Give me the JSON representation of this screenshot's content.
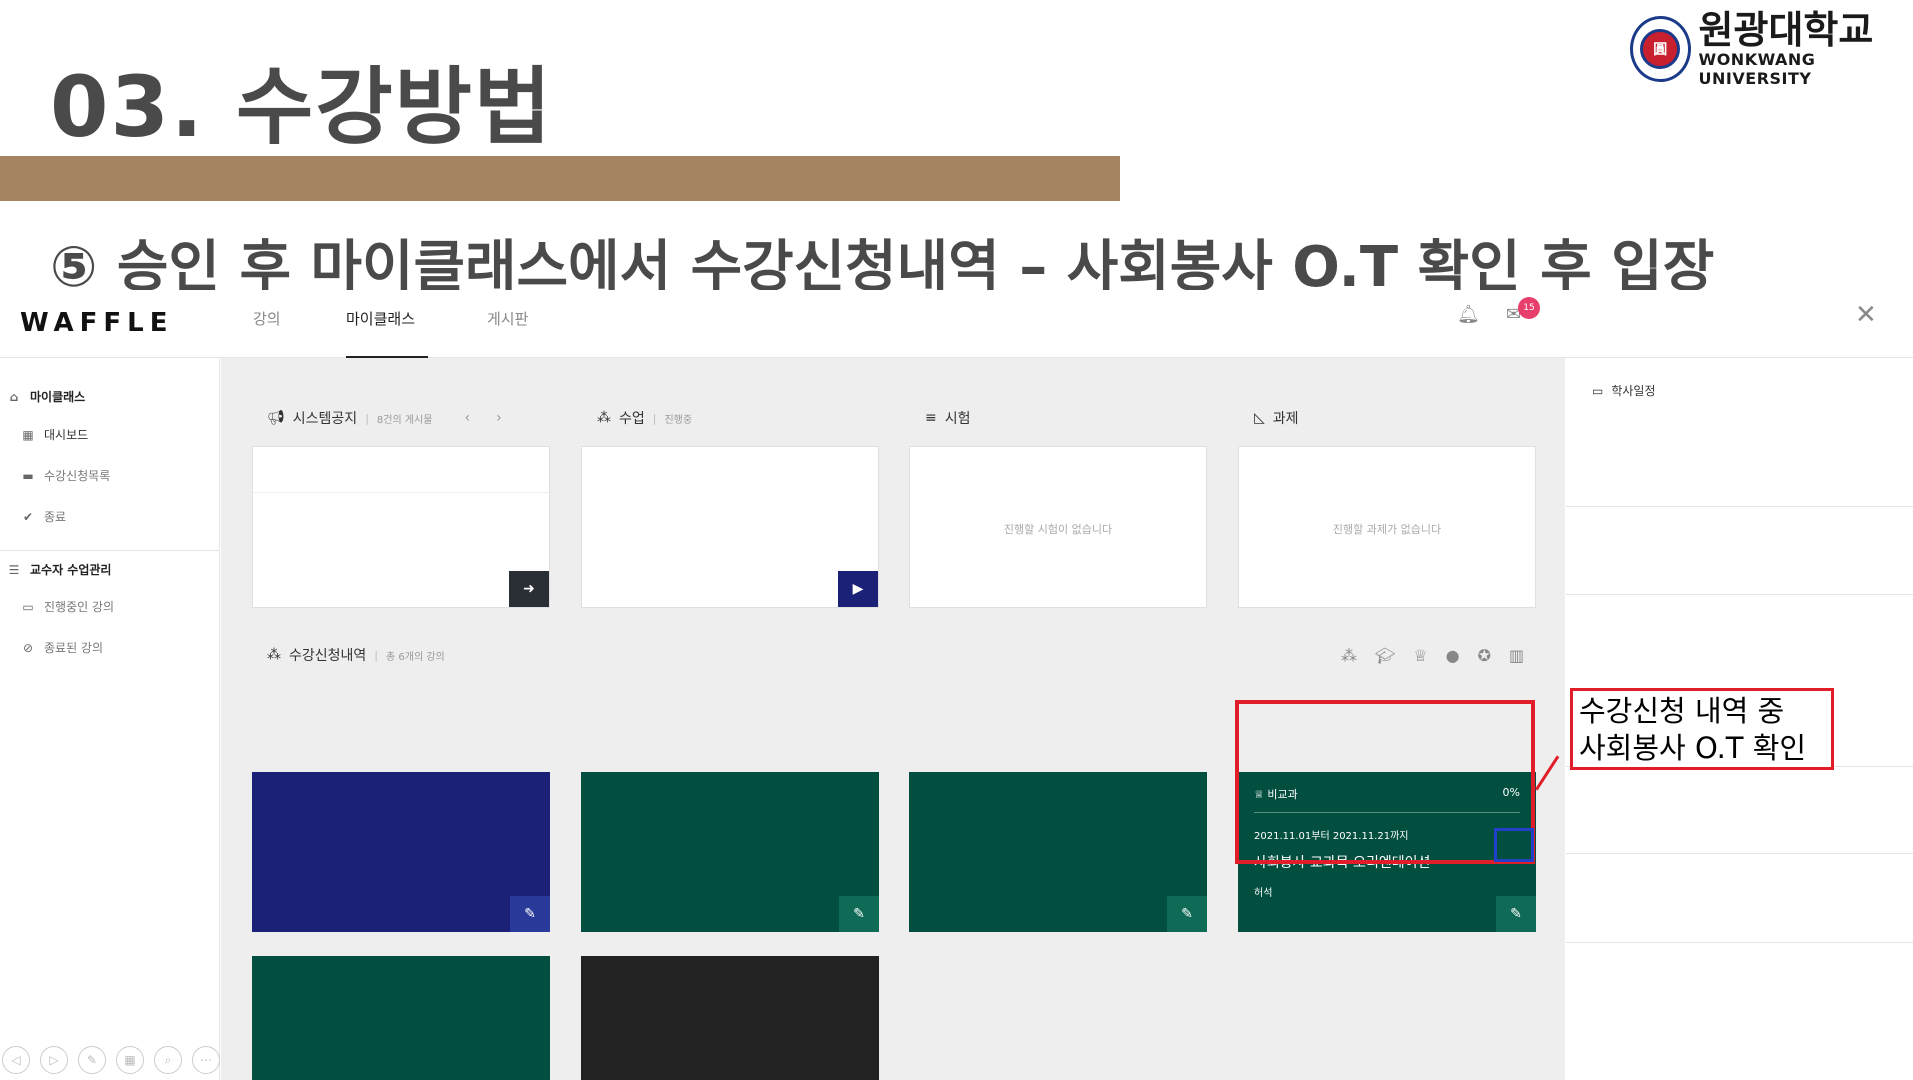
{
  "slide": {
    "title": "03. 수강방법",
    "subtitle": "⑤ 승인 후 마이클래스에서 수강신청내역 – 사회봉사 O.T 확인 후 입장",
    "bar_color": "#a58561",
    "logo": {
      "name_ko": "원광대학교",
      "name_en": "WONKWANG UNIVERSITY"
    }
  },
  "app": {
    "brand": "WAFFLE",
    "nav_tabs": [
      {
        "label": "강의"
      },
      {
        "label": "마이클래스"
      },
      {
        "label": "게시판"
      }
    ],
    "notification_count": "15",
    "sidebar": {
      "myclass_head": "마이클래스",
      "dashboard": "대시보드",
      "enroll_list": "수강신청목록",
      "done": "종료",
      "prof_head": "교수자 수업관리",
      "ongoing": "진행중인 강의",
      "finished": "종료된 강의"
    },
    "sections": {
      "notice": {
        "label": "시스템공지",
        "sub": "8건의 게시물"
      },
      "lesson": {
        "label": "수업",
        "sub": "진행중"
      },
      "exam": {
        "label": "시험",
        "empty": "진행할 시험이 없습니다"
      },
      "assign": {
        "label": "과제",
        "empty": "진행할 과제가 없습니다"
      },
      "enroll": {
        "label": "수강신청내역",
        "sub": "총 6개의 강의"
      }
    },
    "course_detail": {
      "category": "비교과",
      "progress": "0%",
      "dates": "2021.11.01부터 2021.11.21까지",
      "title": "사회봉사 교과목 오리엔테이션",
      "professor": "허석"
    },
    "course_colors": [
      "#1c2178",
      "#024f3f",
      "#024f3f",
      "#024f3f",
      "#024f3f",
      "#222222"
    ],
    "right_panel": {
      "label": "학사일정"
    }
  },
  "annotation": {
    "callout_line1": "수강신청 내역 중",
    "callout_line2": "사회봉사 O.T 확인",
    "highlight_color": "#e11d2a",
    "button_highlight_color": "#2340c8"
  }
}
